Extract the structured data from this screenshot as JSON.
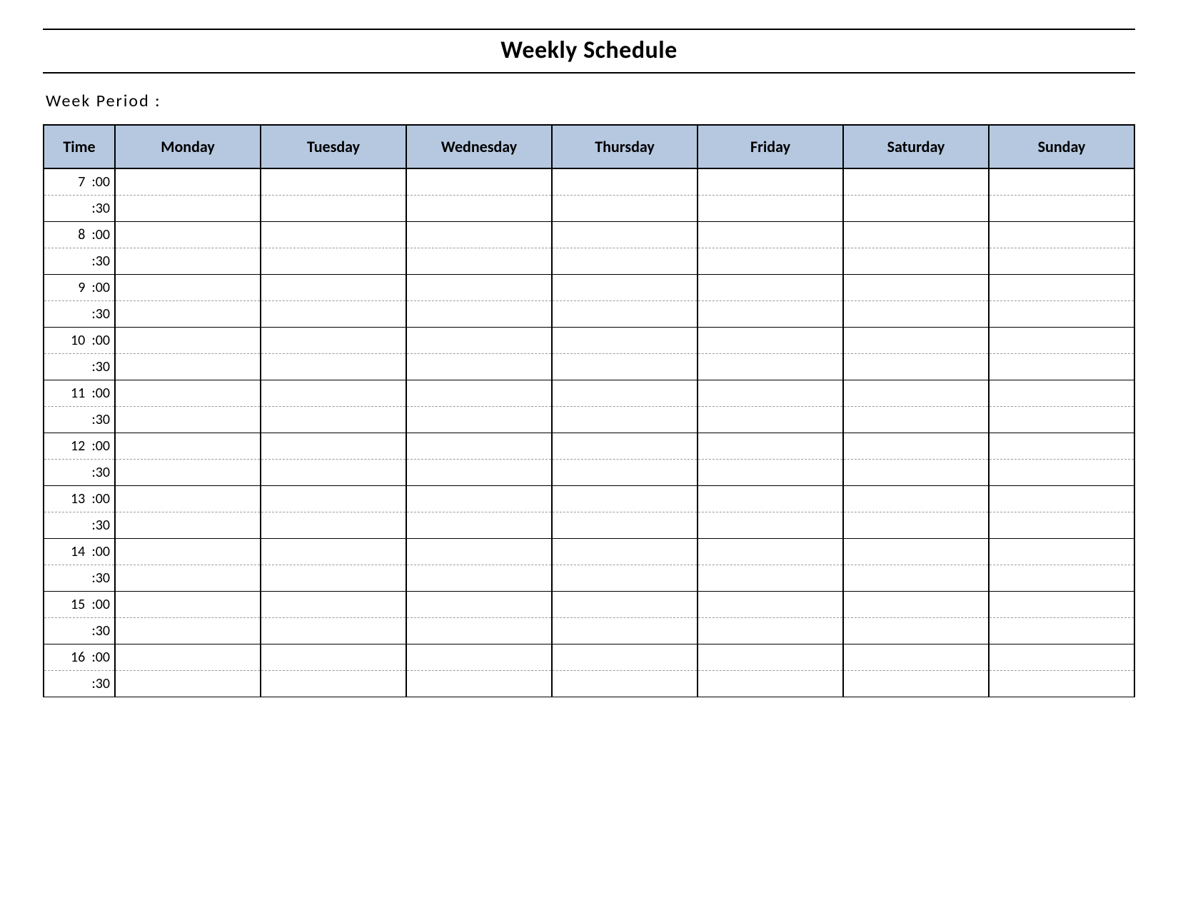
{
  "title": "Weekly Schedule",
  "week_period_label": "Week  Period :",
  "headers": {
    "time": "Time",
    "days": [
      "Monday",
      "Tuesday",
      "Wednesday",
      "Thursday",
      "Friday",
      "Saturday",
      "Sunday"
    ]
  },
  "time_rows": [
    {
      "label": "7  :00",
      "hour_end": false
    },
    {
      "label": ":30",
      "hour_end": true
    },
    {
      "label": "8  :00",
      "hour_end": false
    },
    {
      "label": ":30",
      "hour_end": true
    },
    {
      "label": "9  :00",
      "hour_end": false
    },
    {
      "label": ":30",
      "hour_end": true
    },
    {
      "label": "10  :00",
      "hour_end": false
    },
    {
      "label": ":30",
      "hour_end": true
    },
    {
      "label": "11  :00",
      "hour_end": false
    },
    {
      "label": ":30",
      "hour_end": true
    },
    {
      "label": "12  :00",
      "hour_end": false
    },
    {
      "label": ":30",
      "hour_end": true
    },
    {
      "label": "13  :00",
      "hour_end": false
    },
    {
      "label": ":30",
      "hour_end": true
    },
    {
      "label": "14  :00",
      "hour_end": false
    },
    {
      "label": ":30",
      "hour_end": true
    },
    {
      "label": "15  :00",
      "hour_end": false
    },
    {
      "label": ":30",
      "hour_end": true
    },
    {
      "label": "16  :00",
      "hour_end": false
    },
    {
      "label": ":30",
      "hour_end": true
    }
  ],
  "cells": {}
}
